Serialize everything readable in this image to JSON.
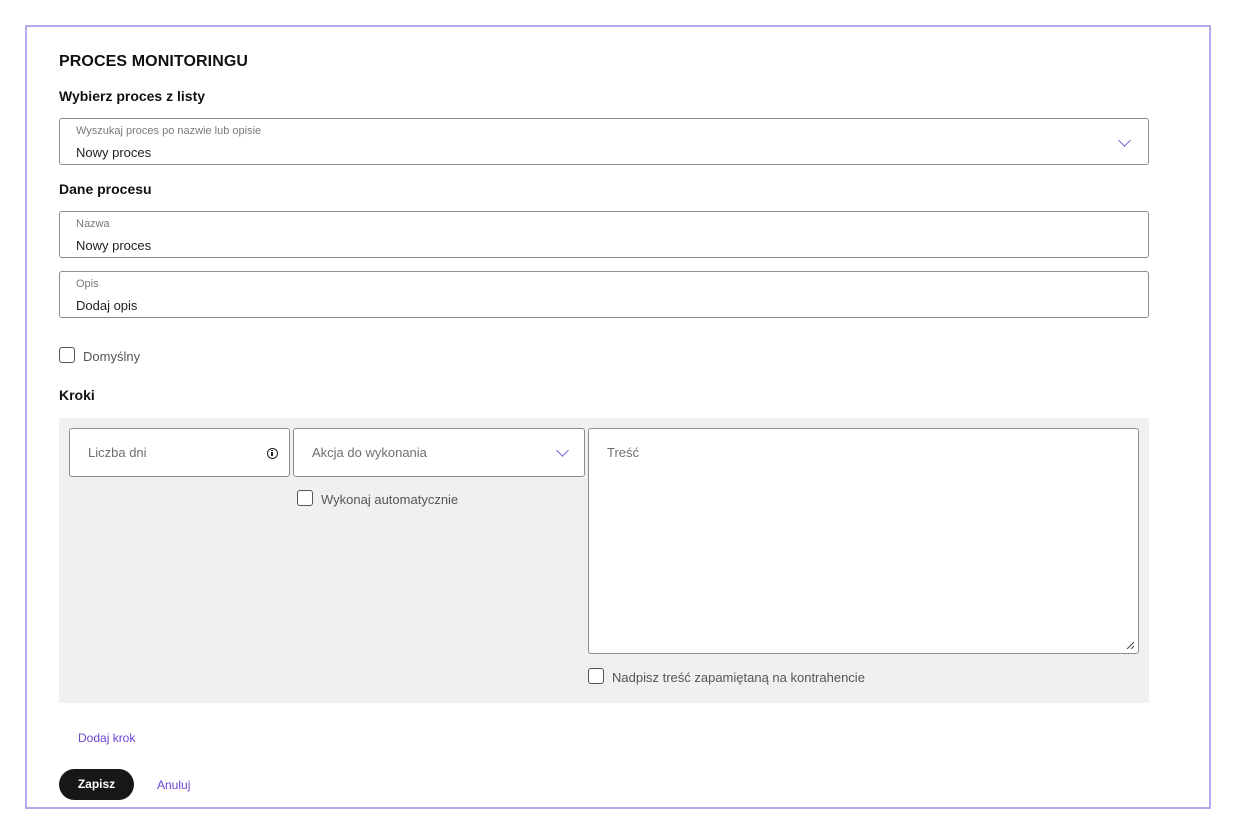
{
  "page": {
    "title": "PROCES MONITORINGU",
    "select_heading": "Wybierz proces z listy",
    "process_search": {
      "label": "Wyszukaj proces po nazwie lub opisie",
      "value": "Nowy proces",
      "icon": "chevron-down-icon"
    },
    "data_heading": "Dane procesu",
    "name_field": {
      "label": "Nazwa",
      "value": "Nowy proces"
    },
    "description_field": {
      "label": "Opis",
      "value": "Dodaj opis"
    },
    "default_checkbox": {
      "label": "Domyślny",
      "checked": false
    },
    "steps_heading": "Kroki"
  },
  "step": {
    "days_placeholder": "Liczba dni",
    "days_icon": "info-icon",
    "action_placeholder": "Akcja do wykonania",
    "auto_checkbox": {
      "label": "Wykonaj automatycznie",
      "checked": false
    },
    "content_placeholder": "Treść",
    "override_checkbox": {
      "label": "Nadpisz treść zapamiętaną na kontrahencie",
      "checked": false
    }
  },
  "actions": {
    "add_step": "Dodaj krok",
    "save": "Zapisz",
    "cancel": "Anuluj"
  },
  "colors": {
    "accent": "#6a45d1",
    "frame_border": "#b9a7ee",
    "primary_button": "#17171a",
    "steps_background": "#f0f0f0"
  }
}
